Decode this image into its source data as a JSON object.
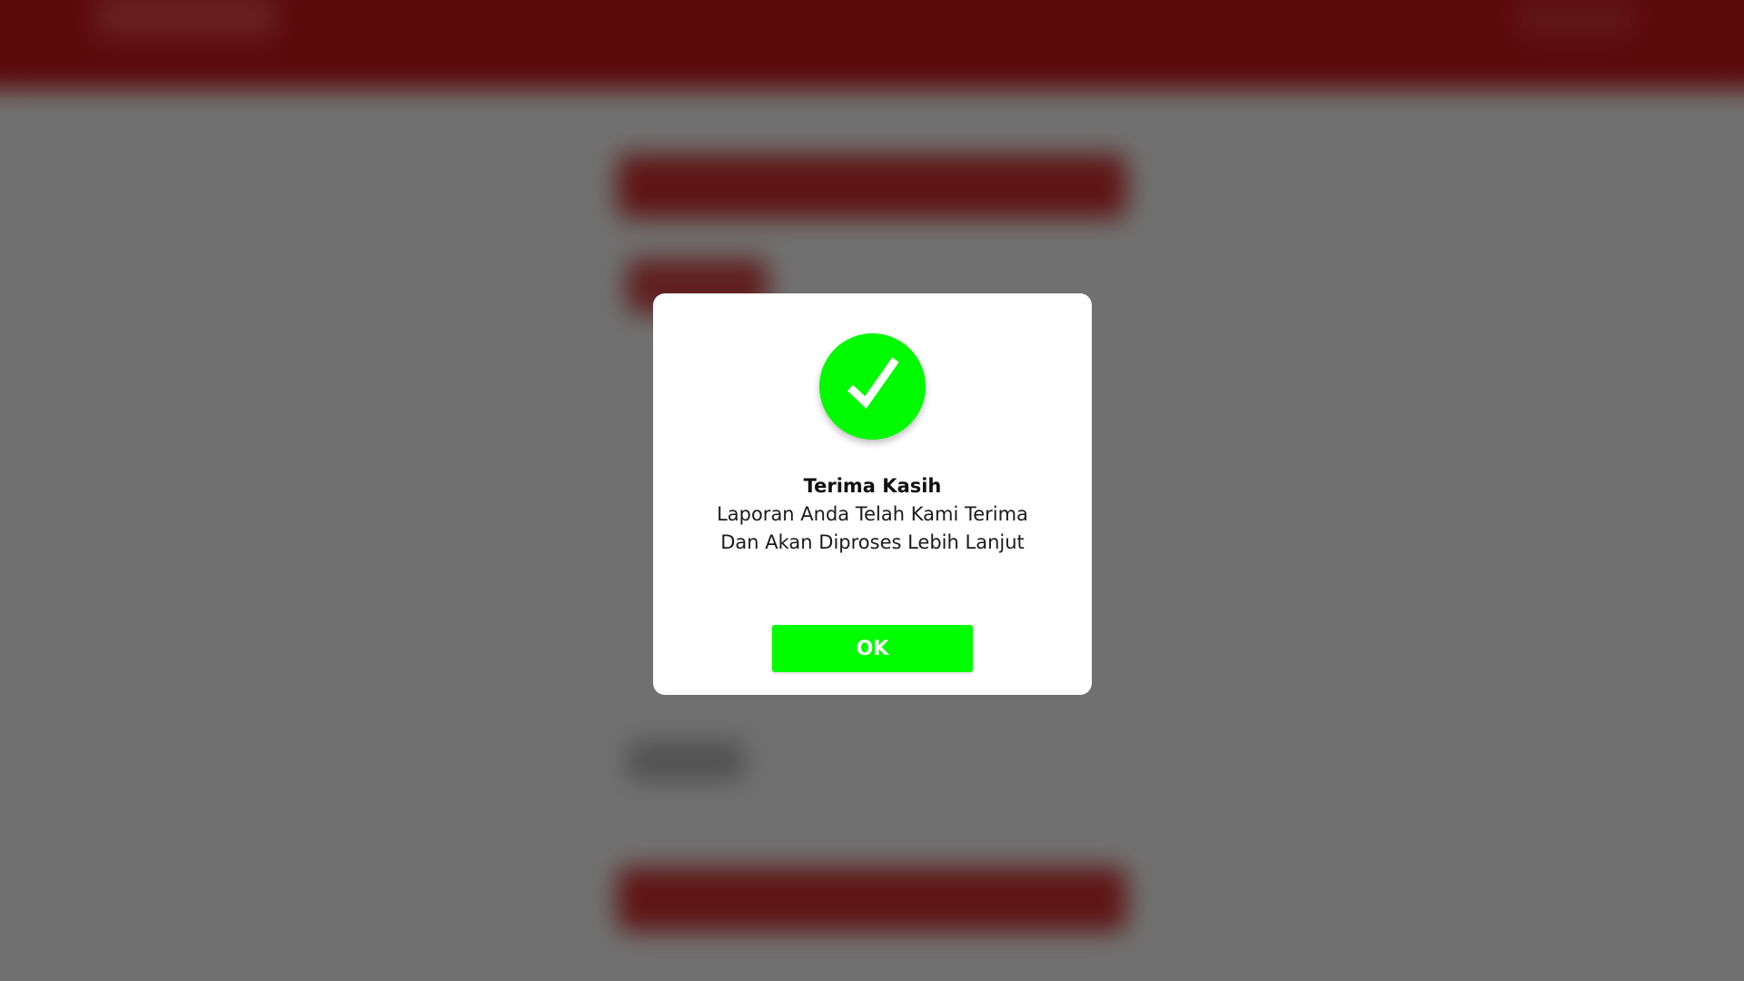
{
  "dialog": {
    "icon": "check-circle-icon",
    "title": "Terima Kasih",
    "message_line_1": "Laporan Anda Telah Kami Terima",
    "message_line_2": "Dan Akan Diproses Lebih Lanjut",
    "ok_label": "OK"
  },
  "colors": {
    "accent_success": "#00fa00",
    "header_brand": "#cf1717",
    "overlay": "rgba(0,0,0,0.56)",
    "dialog_background": "#ffffff"
  }
}
